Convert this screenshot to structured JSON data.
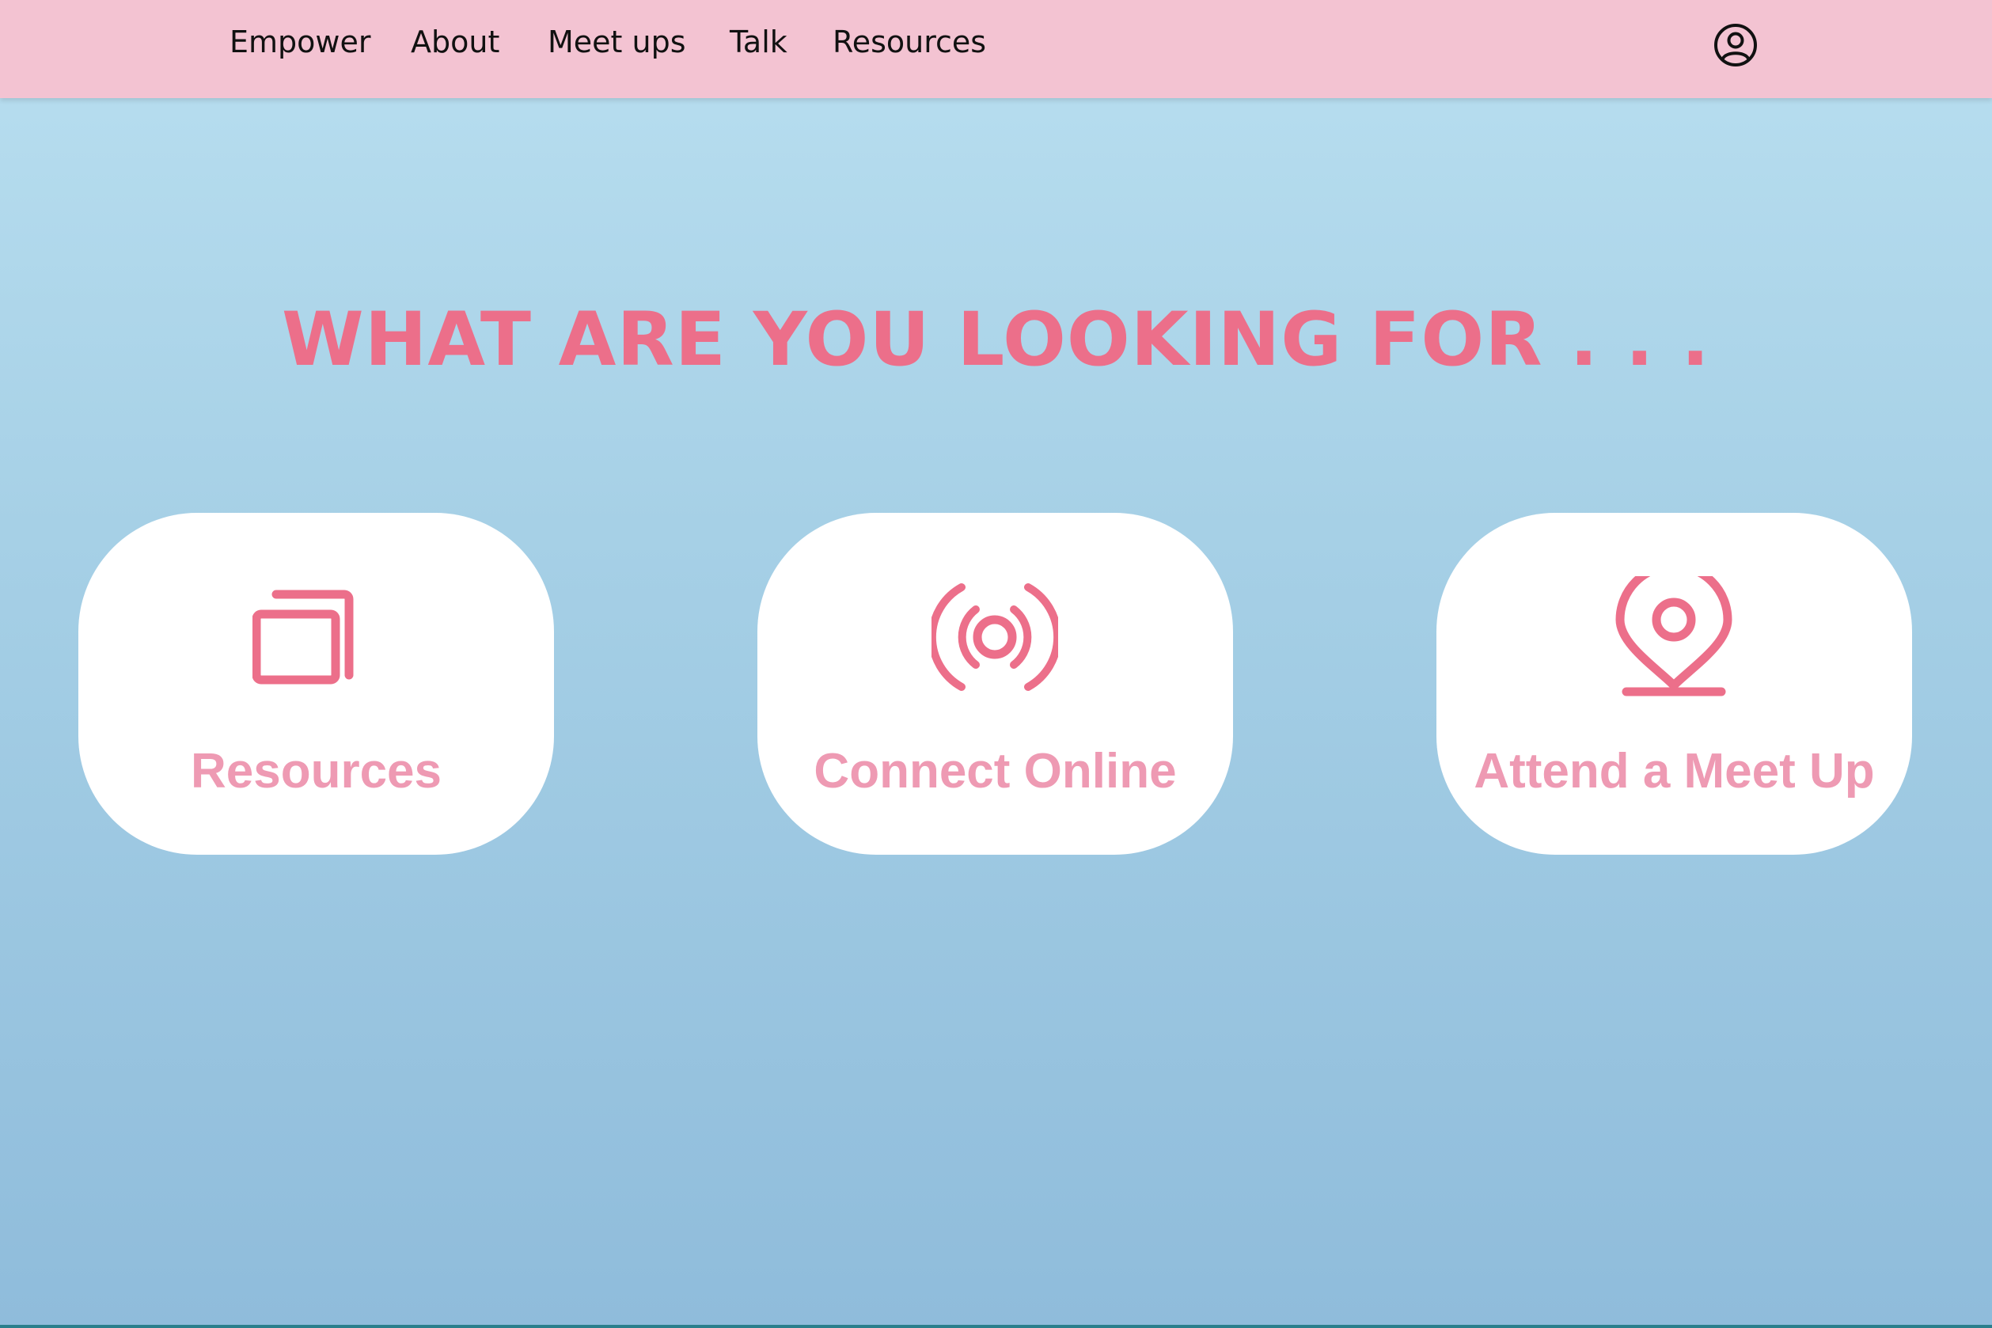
{
  "nav": {
    "links": [
      "Empower",
      "About",
      "Meet ups",
      "Talk",
      "Resources"
    ],
    "account_icon": "user-circle-icon"
  },
  "main": {
    "heading": "WHAT ARE YOU LOOKING FOR . . ."
  },
  "cards": [
    {
      "label": "Resources",
      "icon": "stacked-windows-icon"
    },
    {
      "label": "Connect Online",
      "icon": "broadcast-icon"
    },
    {
      "label": "Attend a Meet Up",
      "icon": "map-pin-icon"
    }
  ],
  "colors": {
    "nav_background": "#f3c3d2",
    "heading": "#ec6f8a",
    "icon": "#ec6f8a",
    "card_label": "#ee9ab3",
    "card_background": "#ffffff",
    "page_gradient_top": "#b9dff0",
    "page_gradient_bottom": "#8fbcdb"
  }
}
